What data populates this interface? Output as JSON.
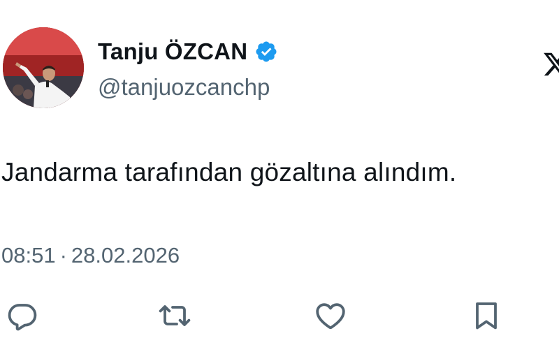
{
  "tweet": {
    "display_name": "Tanju ÖZCAN",
    "handle": "@tanjuozcanchp",
    "verified": true,
    "text": "Jandarma tarafından gözaltına alındım.",
    "time": "08:51",
    "separator": "·",
    "date": "28.02.2026"
  },
  "icons": {
    "verified": "verified-badge-icon",
    "platform": "x-logo-icon",
    "reply": "reply-icon",
    "retweet": "retweet-icon",
    "like": "heart-icon",
    "bookmark": "bookmark-icon"
  },
  "colors": {
    "text": "#0f1419",
    "secondary": "#536471",
    "verified": "#1d9bf0"
  }
}
